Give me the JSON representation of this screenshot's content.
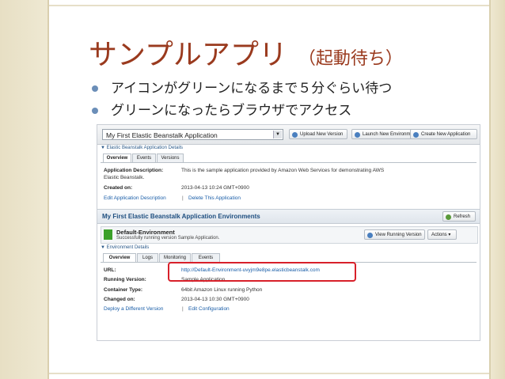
{
  "slide": {
    "title": "サンプルアプリ",
    "title_sub": "（起動待ち）",
    "bullets": [
      "アイコンがグリーンになるまで５分ぐらい待つ",
      "グリーンになったらブラウザでアクセス"
    ]
  },
  "console": {
    "app_select": "My First Elastic Beanstalk Application",
    "toolbar": {
      "upload": "Upload New Version",
      "launch": "Launch New Environment",
      "create": "Create New Application"
    },
    "app_details": {
      "header": "▼ Elastic Beanstalk Application Details",
      "tabs": [
        "Overview",
        "Events",
        "Versions"
      ],
      "description_label": "Application Description:",
      "description_value": "This is the sample application provided by Amazon Web Services for demonstrating AWS",
      "description_value2": "Elastic Beanstalk.",
      "created_label": "Created on:",
      "created_value": "2013-04-13 10:24 GMT+0900",
      "edit_link": "Edit Application Description",
      "delete_link": "Delete This Application",
      "sep": "|"
    },
    "environments": {
      "title": "My First Elastic Beanstalk Application Environments",
      "refresh": "Refresh",
      "env_name": "Default-Environment",
      "env_status_text": "Successfully running version Sample Application.",
      "view_running": "View Running Version",
      "actions": "Actions ▾"
    },
    "env_details": {
      "header": "▼ Environment Details",
      "tabs": [
        "Overview",
        "Logs",
        "Monitoring",
        "Events"
      ],
      "url_label": "URL:",
      "url_value": "http://Default-Environment-uvyjm9e8pe.elasticbeanstalk.com",
      "running_label": "Running Version:",
      "running_value": "Sample Application",
      "container_label": "Container Type:",
      "container_value": "64bit Amazon Linux running Python",
      "changed_label": "Changed on:",
      "changed_value": "2013-04-13 10:30 GMT+0900",
      "deploy_link": "Deploy a Different Version",
      "edit_config_link": "Edit Configuration",
      "sep": "|"
    }
  },
  "colors": {
    "title": "#9a3a1e",
    "bullet": "#6b8eb8",
    "status_green": "#3ba02a",
    "highlight": "#d8202a",
    "link": "#1a5ea8"
  }
}
